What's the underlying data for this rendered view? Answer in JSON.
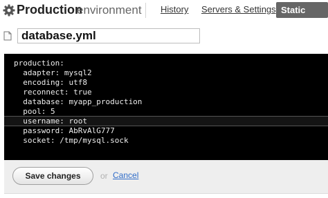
{
  "header": {
    "title": "Production",
    "subtitle": "environment",
    "icon": "gear-icon",
    "tabs": [
      {
        "label": "History",
        "active": false
      },
      {
        "label": "Servers & Settings",
        "active": false
      },
      {
        "label": "Static files",
        "active": true
      }
    ]
  },
  "file": {
    "icon": "file-icon",
    "name": "database.yml"
  },
  "editor": {
    "lines": [
      "production:",
      "  adapter: mysql2",
      "  encoding: utf8",
      "  reconnect: true",
      "  database: myapp_production",
      "  pool: 5",
      "  username: root",
      "  password: AbRvAlG777",
      "  socket: /tmp/mysql.sock"
    ],
    "highlighted_line": 7
  },
  "footer": {
    "save_label": "Save changes",
    "or_text": "or",
    "cancel_label": "Cancel"
  },
  "colors": {
    "active_tab_bg": "#666666",
    "editor_bg": "#000000",
    "link": "#2e6bc8"
  }
}
